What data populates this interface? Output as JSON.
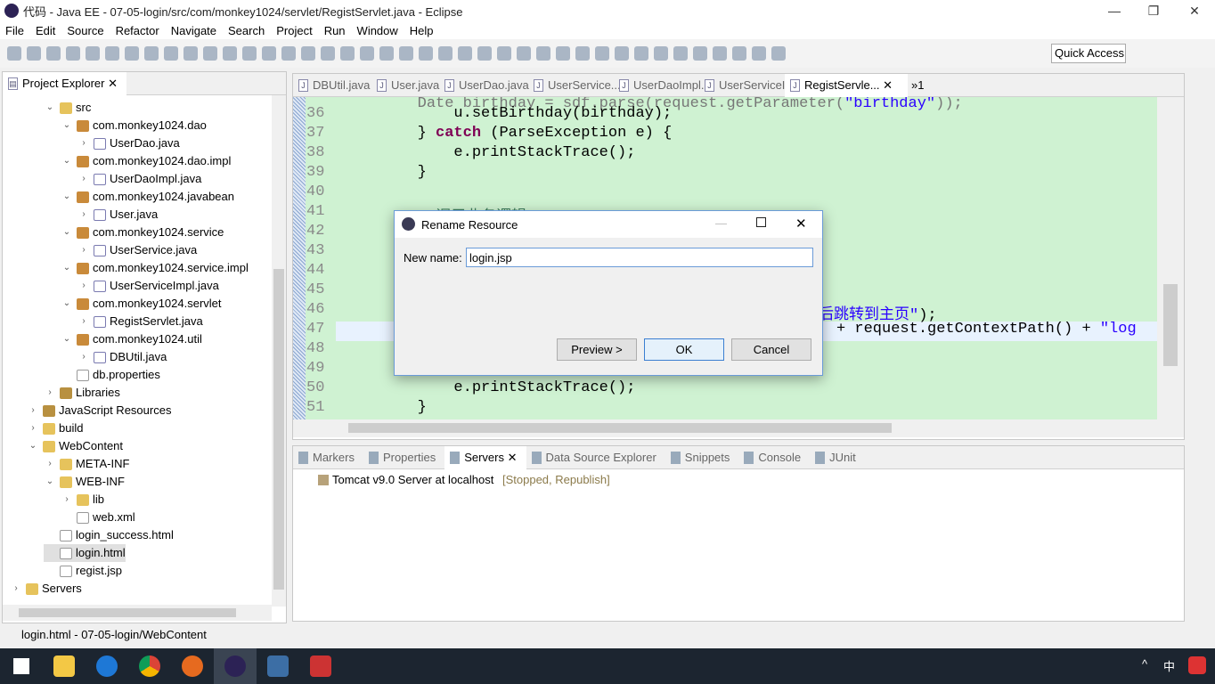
{
  "window": {
    "title": "代码 - Java EE - 07-05-login/src/com/monkey1024/servlet/RegistServlet.java - Eclipse",
    "minimize": "—",
    "restore": "❐",
    "close": "✕"
  },
  "menu": [
    "File",
    "Edit",
    "Source",
    "Refactor",
    "Navigate",
    "Search",
    "Project",
    "Run",
    "Window",
    "Help"
  ],
  "quick_access": "Quick Access",
  "project_explorer": {
    "tab": "Project Explorer",
    "items": [
      {
        "label": "src",
        "level": 2,
        "icon": "folder",
        "open": true
      },
      {
        "label": "com.monkey1024.dao",
        "level": 3,
        "icon": "package",
        "open": true
      },
      {
        "label": "UserDao.java",
        "level": 4,
        "icon": "java"
      },
      {
        "label": "com.monkey1024.dao.impl",
        "level": 3,
        "icon": "package",
        "open": true
      },
      {
        "label": "UserDaoImpl.java",
        "level": 4,
        "icon": "java"
      },
      {
        "label": "com.monkey1024.javabean",
        "level": 3,
        "icon": "package",
        "open": true
      },
      {
        "label": "User.java",
        "level": 4,
        "icon": "java"
      },
      {
        "label": "com.monkey1024.service",
        "level": 3,
        "icon": "package",
        "open": true
      },
      {
        "label": "UserService.java",
        "level": 4,
        "icon": "java"
      },
      {
        "label": "com.monkey1024.service.impl",
        "level": 3,
        "icon": "package",
        "open": true
      },
      {
        "label": "UserServiceImpl.java",
        "level": 4,
        "icon": "java"
      },
      {
        "label": "com.monkey1024.servlet",
        "level": 3,
        "icon": "package",
        "open": true
      },
      {
        "label": "RegistServlet.java",
        "level": 4,
        "icon": "java"
      },
      {
        "label": "com.monkey1024.util",
        "level": 3,
        "icon": "package",
        "open": true
      },
      {
        "label": "DBUtil.java",
        "level": 4,
        "icon": "java"
      },
      {
        "label": "db.properties",
        "level": 3,
        "icon": "file",
        "leaf": true
      },
      {
        "label": "Libraries",
        "level": 2,
        "icon": "lib",
        "open": false
      },
      {
        "label": "JavaScript Resources",
        "level": 1,
        "icon": "lib",
        "open": false
      },
      {
        "label": "build",
        "level": 1,
        "icon": "folder",
        "open": false
      },
      {
        "label": "WebContent",
        "level": 1,
        "icon": "folder",
        "open": true
      },
      {
        "label": "META-INF",
        "level": 2,
        "icon": "folder",
        "open": false
      },
      {
        "label": "WEB-INF",
        "level": 2,
        "icon": "folder",
        "open": true
      },
      {
        "label": "lib",
        "level": 3,
        "icon": "folder",
        "open": false
      },
      {
        "label": "web.xml",
        "level": 3,
        "icon": "file",
        "leaf": true
      },
      {
        "label": "login_success.html",
        "level": 2,
        "icon": "file",
        "leaf": true
      },
      {
        "label": "login.html",
        "level": 2,
        "icon": "file",
        "leaf": true,
        "selected": true
      },
      {
        "label": "regist.jsp",
        "level": 2,
        "icon": "file",
        "leaf": true
      },
      {
        "label": "Servers",
        "level": 0,
        "icon": "folder",
        "open": false
      }
    ]
  },
  "editor": {
    "tabs": [
      "DBUtil.java",
      "User.java",
      "UserDao.java",
      "UserService....",
      "UserDaoImpl....",
      "UserServiceI...",
      "RegistServle..."
    ],
    "active_tab": 6,
    "overflow": "»1",
    "lines": [
      {
        "n": "36",
        "code": "            u.setBirthday(birthday);"
      },
      {
        "n": "37",
        "code": "        } ",
        "kw": "catch",
        "rest": " (ParseException e) {"
      },
      {
        "n": "38",
        "code": "            e.printStackTrace();"
      },
      {
        "n": "39",
        "code": "        }"
      },
      {
        "n": "40",
        "code": ""
      },
      {
        "n": "41",
        "comment": "        //调用业务逻辑"
      },
      {
        "n": "42",
        "code": ""
      },
      {
        "n": "43",
        "code": ""
      },
      {
        "n": "44",
        "code": ""
      },
      {
        "n": "45",
        "code": ""
      },
      {
        "n": "46",
        "str": "后跳转到主页\"",
        "rest": ");"
      },
      {
        "n": "47",
        "code": "+ request.getContextPath() + ",
        "str": "\"log"
      },
      {
        "n": "48",
        "code": ""
      },
      {
        "n": "49",
        "code": ""
      },
      {
        "n": "50",
        "code": "            e.printStackTrace();"
      },
      {
        "n": "51",
        "code": "        }"
      }
    ]
  },
  "bottom": {
    "tabs": [
      "Markers",
      "Properties",
      "Servers",
      "Data Source Explorer",
      "Snippets",
      "Console",
      "JUnit"
    ],
    "active_tab": 2,
    "server": "Tomcat v9.0 Server at localhost",
    "server_state": "[Stopped, Republish]"
  },
  "status": "login.html - 07-05-login/WebContent",
  "dialog": {
    "title": "Rename Resource",
    "label": "New name:",
    "value": "login.jsp",
    "preview": "Preview >",
    "ok": "OK",
    "cancel": "Cancel"
  },
  "taskbar": {
    "ime": "中"
  }
}
